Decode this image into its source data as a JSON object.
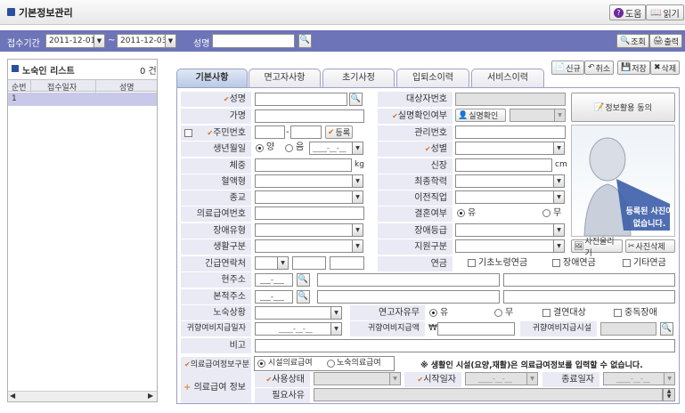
{
  "window": {
    "title": "기본정보관리",
    "help_label": "도움",
    "read_label": "읽기"
  },
  "search": {
    "period_label": "접수기간",
    "date_from": "2011-12-01",
    "date_sep": "~",
    "date_to": "2011-12-03",
    "name_label": "성명",
    "query_label": "조회",
    "print_label": "출력"
  },
  "list": {
    "title": "노숙인 리스트",
    "count": "0 건",
    "columns": [
      "순번",
      "접수일자",
      "성명"
    ],
    "rows": [
      [
        "1",
        "",
        ""
      ]
    ]
  },
  "tabs": [
    "기본사항",
    "면고자사항",
    "초기사정",
    "입퇴소이력",
    "서비스이력"
  ],
  "actions": {
    "new": "신규",
    "cancel": "취소",
    "save": "저장",
    "delete": "삭제"
  },
  "form": {
    "name": "성명",
    "alias": "가명",
    "rrn": "주민번호",
    "register": "등록",
    "birth": "생년월일",
    "solar": "양",
    "lunar": "음",
    "birth_value": "____-__-__",
    "weight": "체중",
    "kg": "kg",
    "blood": "혈액형",
    "religion": "종교",
    "medical_no": "의료급여번호",
    "disability": "장애유형",
    "living": "생활구분",
    "emergency": "긴급연락처",
    "target_no": "대상자번호",
    "real_name": "실명확인여부",
    "real_name_btn": "실명확인",
    "manage_no": "관리번호",
    "gender": "성별",
    "height": "신장",
    "cm": "cm",
    "education": "최종학력",
    "prev_job": "이전직업",
    "married": "결혼여부",
    "yes": "유",
    "no": "무",
    "disability_grade": "장애등급",
    "support": "지원구분",
    "pension": "연금",
    "pension_basic": "기초노령연금",
    "pension_disab": "장애연금",
    "pension_etc": "기타연금",
    "info_consent": "정보활용 동의",
    "photo_text1": "등록된 사진이",
    "photo_text2": "없습니다.",
    "photo_upload": "사진올리기",
    "photo_delete": "사진삭제",
    "current_addr": "현주소",
    "origin_addr": "본적주소",
    "zip_mask": "___-___",
    "homeless": "노숙상황",
    "has_family": "연고자유무",
    "transfer": "결연대상",
    "alcohol": "중독장애",
    "return_date": "귀향여비지급일자",
    "return_amount": "귀향여비지급액",
    "won": "₩",
    "return_place": "귀향여비지급시설",
    "return_date_value": "____-__-__",
    "note": "비고",
    "med_type": "의료급여정보구분",
    "med_facility": "시설의료급여",
    "med_homeless": "노숙의료급여",
    "med_notice": "※ 생활인 시설(요양,재활)은 의료급여정보를 입력할 수 없습니다.",
    "med_info": "의료급여 정보",
    "use_status": "사용상태",
    "start_date": "시작일자",
    "end_date": "종료일자",
    "date_mask": "____-__-__",
    "reason": "필요사유"
  },
  "colors": {
    "searchbar": "#6d75b8",
    "label_bg": "#e9eaf4",
    "required": "#e07020",
    "selected_row": "#c8c8ea"
  }
}
